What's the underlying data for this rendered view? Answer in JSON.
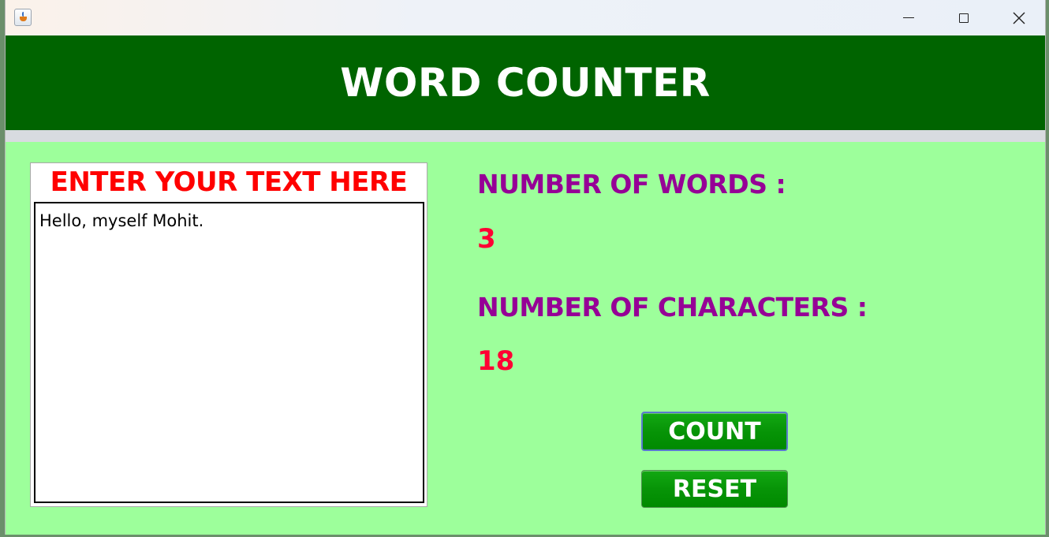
{
  "window": {
    "title_bar_buttons": [
      "minimize",
      "maximize",
      "close"
    ],
    "app_icon": "java-cup-icon"
  },
  "header": {
    "title": "WORD COUNTER"
  },
  "input": {
    "label": "ENTER YOUR TEXT HERE",
    "value": "Hello, myself Mohit."
  },
  "stats": {
    "words_label": "NUMBER OF WORDS :",
    "words_value": "3",
    "chars_label": "NUMBER OF CHARACTERS :",
    "chars_value": "18"
  },
  "actions": {
    "count_label": "COUNT",
    "reset_label": "RESET"
  },
  "colors": {
    "header_bg": "#006400",
    "panel_bg": "#9dff9b",
    "input_label": "#ff0000",
    "stat_label": "#960096",
    "stat_value": "#ff0033",
    "button_bg": "#008a00"
  }
}
